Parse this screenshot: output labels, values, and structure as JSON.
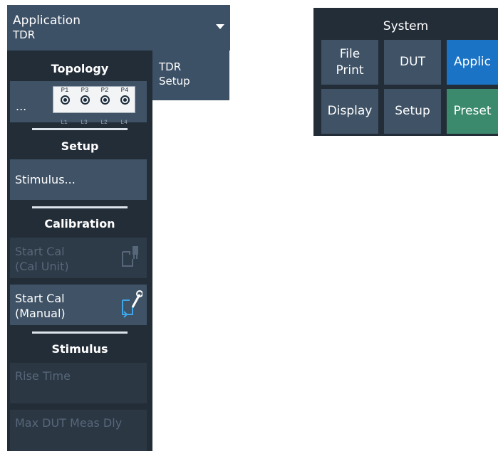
{
  "header": {
    "title": "Application",
    "subtitle": "TDR"
  },
  "tab": {
    "label_line1": "TDR",
    "label_line2": "Setup"
  },
  "topology": {
    "title": "Topology",
    "button_label": "...",
    "ports": [
      "P1",
      "P3",
      "P2",
      "P4"
    ],
    "lines": [
      "L1",
      "L3",
      "L2",
      "L4"
    ]
  },
  "setup": {
    "title": "Setup",
    "stimulus_button": "Stimulus..."
  },
  "calibration": {
    "title": "Calibration",
    "cal_unit_line1": "Start Cal",
    "cal_unit_line2": "(Cal Unit)",
    "manual_line1": "Start Cal",
    "manual_line2": "(Manual)"
  },
  "stimulus": {
    "title": "Stimulus",
    "rise_time": "Rise Time",
    "max_dut": "Max DUT Meas Dly"
  },
  "system": {
    "title": "System",
    "file_print_line1": "File",
    "file_print_line2": "Print",
    "dut": "DUT",
    "applic": "Applic",
    "display": "Display",
    "setup": "Setup",
    "preset": "Preset"
  },
  "colors": {
    "panel": "#232d37",
    "button": "#3f5266",
    "header": "#3d5166",
    "applic": "#1a73c4",
    "preset": "#3c8a6e"
  }
}
